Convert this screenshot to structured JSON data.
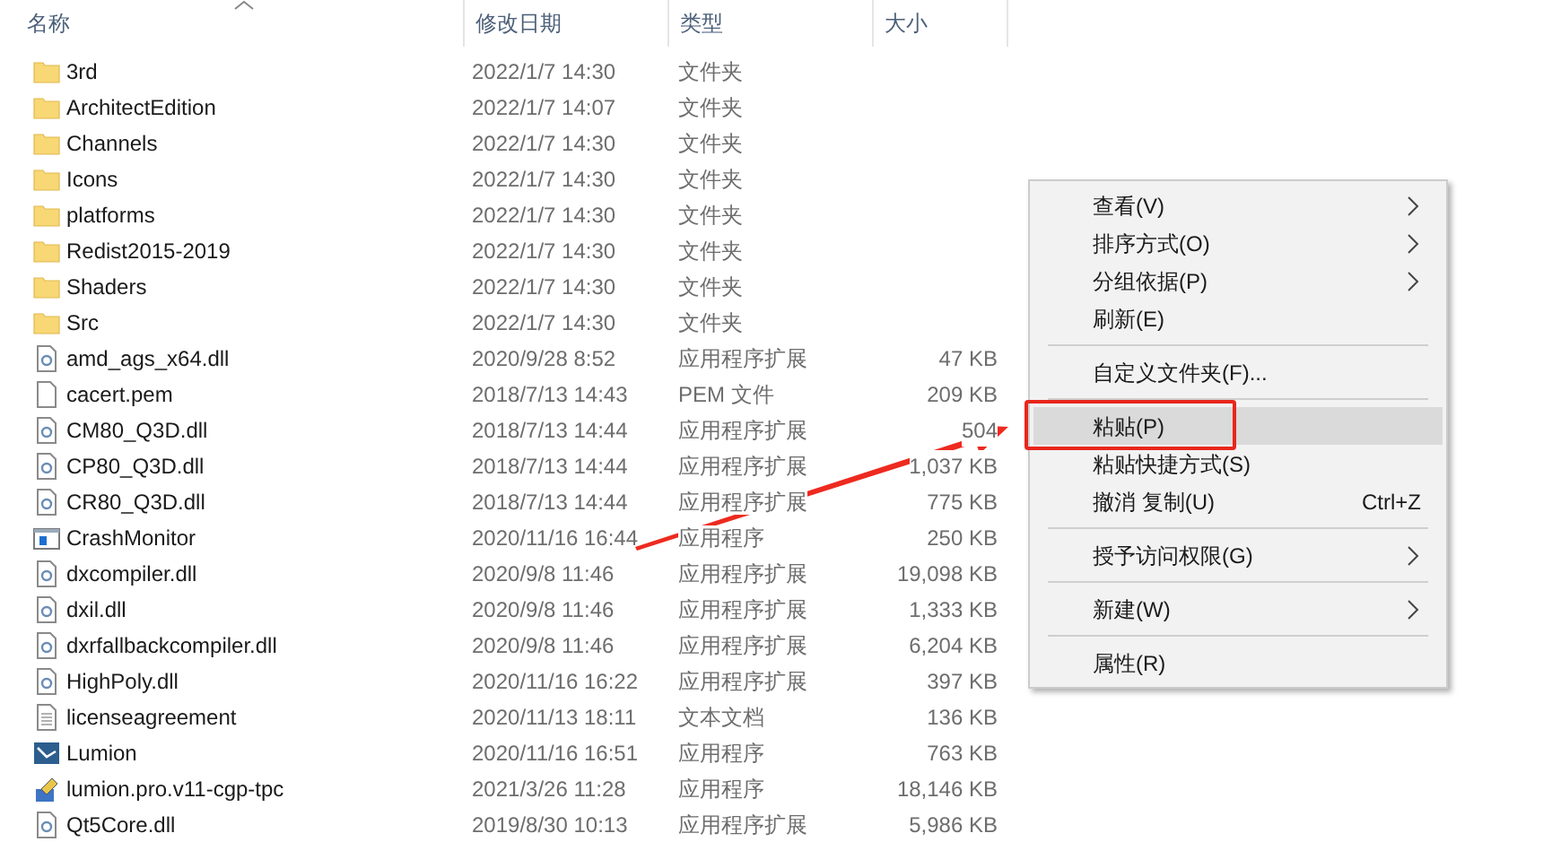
{
  "columns": [
    "名称",
    "修改日期",
    "类型",
    "大小"
  ],
  "files": [
    {
      "name": "3rd",
      "date": "2022/1/7 14:30",
      "type": "文件夹",
      "kind": "folder"
    },
    {
      "name": "ArchitectEdition",
      "date": "2022/1/7 14:07",
      "type": "文件夹",
      "kind": "folder"
    },
    {
      "name": "Channels",
      "date": "2022/1/7 14:30",
      "type": "文件夹",
      "kind": "folder"
    },
    {
      "name": "Icons",
      "date": "2022/1/7 14:30",
      "type": "文件夹",
      "kind": "folder"
    },
    {
      "name": "platforms",
      "date": "2022/1/7 14:30",
      "type": "文件夹",
      "kind": "folder"
    },
    {
      "name": "Redist2015-2019",
      "date": "2022/1/7 14:30",
      "type": "文件夹",
      "kind": "folder"
    },
    {
      "name": "Shaders",
      "date": "2022/1/7 14:30",
      "type": "文件夹",
      "kind": "folder"
    },
    {
      "name": "Src",
      "date": "2022/1/7 14:30",
      "type": "文件夹",
      "kind": "folder"
    },
    {
      "name": "amd_ags_x64.dll",
      "date": "2020/9/28 8:52",
      "type": "应用程序扩展",
      "size": "47 KB",
      "kind": "dll"
    },
    {
      "name": "cacert.pem",
      "date": "2018/7/13 14:43",
      "type": "PEM 文件",
      "size": "209 KB",
      "kind": "file"
    },
    {
      "name": "CM80_Q3D.dll",
      "date": "2018/7/13 14:44",
      "type": "应用程序扩展",
      "size": "504",
      "kind": "dll"
    },
    {
      "name": "CP80_Q3D.dll",
      "date": "2018/7/13 14:44",
      "type": "应用程序扩展",
      "size": "1,037 KB",
      "kind": "dll"
    },
    {
      "name": "CR80_Q3D.dll",
      "date": "2018/7/13 14:44",
      "type": "应用程序扩展",
      "size": "775 KB",
      "kind": "dll"
    },
    {
      "name": "CrashMonitor",
      "date": "2020/11/16 16:44",
      "type": "应用程序",
      "size": "250 KB",
      "kind": "app"
    },
    {
      "name": "dxcompiler.dll",
      "date": "2020/9/8 11:46",
      "type": "应用程序扩展",
      "size": "19,098 KB",
      "kind": "dll"
    },
    {
      "name": "dxil.dll",
      "date": "2020/9/8 11:46",
      "type": "应用程序扩展",
      "size": "1,333 KB",
      "kind": "dll"
    },
    {
      "name": "dxrfallbackcompiler.dll",
      "date": "2020/9/8 11:46",
      "type": "应用程序扩展",
      "size": "6,204 KB",
      "kind": "dll"
    },
    {
      "name": "HighPoly.dll",
      "date": "2020/11/16 16:22",
      "type": "应用程序扩展",
      "size": "397 KB",
      "kind": "dll"
    },
    {
      "name": "licenseagreement",
      "date": "2020/11/13 18:11",
      "type": "文本文档",
      "size": "136 KB",
      "kind": "text"
    },
    {
      "name": "Lumion",
      "date": "2020/11/16 16:51",
      "type": "应用程序",
      "size": "763 KB",
      "kind": "lumion"
    },
    {
      "name": "lumion.pro.v11-cgp-tpc",
      "date": "2021/3/26 11:28",
      "type": "应用程序",
      "size": "18,146 KB",
      "kind": "setup"
    },
    {
      "name": "Qt5Core.dll",
      "date": "2019/8/30 10:13",
      "type": "应用程序扩展",
      "size": "5,986 KB",
      "kind": "dll"
    }
  ],
  "context_menu": [
    {
      "kind": "item",
      "label": "查看(V)",
      "submenu": true,
      "selected": false
    },
    {
      "kind": "item",
      "label": "排序方式(O)",
      "submenu": true,
      "selected": false
    },
    {
      "kind": "item",
      "label": "分组依据(P)",
      "submenu": true,
      "selected": false
    },
    {
      "kind": "item",
      "label": "刷新(E)",
      "submenu": false,
      "selected": false
    },
    {
      "kind": "separator"
    },
    {
      "kind": "item",
      "label": "自定义文件夹(F)...",
      "submenu": false,
      "selected": false
    },
    {
      "kind": "separator"
    },
    {
      "kind": "item",
      "label": "粘贴(P)",
      "submenu": false,
      "selected": true
    },
    {
      "kind": "item",
      "label": "粘贴快捷方式(S)",
      "submenu": false,
      "selected": false
    },
    {
      "kind": "item",
      "label": "撤消 复制(U)",
      "shortcut": "Ctrl+Z",
      "submenu": false,
      "selected": false
    },
    {
      "kind": "separator"
    },
    {
      "kind": "item",
      "label": "授予访问权限(G)",
      "submenu": true,
      "selected": false
    },
    {
      "kind": "separator"
    },
    {
      "kind": "item",
      "label": "新建(W)",
      "submenu": true,
      "selected": false
    },
    {
      "kind": "separator"
    },
    {
      "kind": "item",
      "label": "属性(R)",
      "submenu": false,
      "selected": false
    }
  ]
}
